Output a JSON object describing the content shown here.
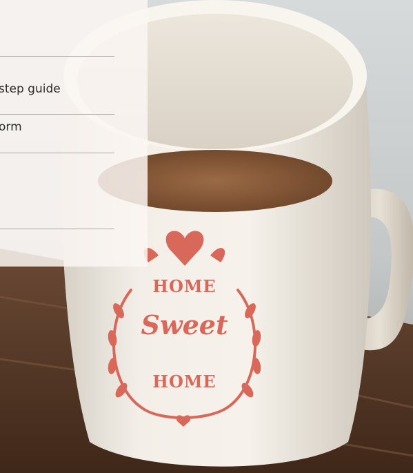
{
  "menu": {
    "items": [
      {
        "label": "step guide"
      },
      {
        "label": "orm"
      },
      {
        "label": ""
      }
    ]
  },
  "mug": {
    "print_line_1": "HOME",
    "print_line_2": "Sweet",
    "print_line_3": "HOME"
  },
  "colors": {
    "divider": "#f0974f",
    "print": "#d8685a",
    "mug": "#f1ede6",
    "tea": "#8a5a3a",
    "background": "#cdd2d4",
    "table": "#5b3a27"
  }
}
